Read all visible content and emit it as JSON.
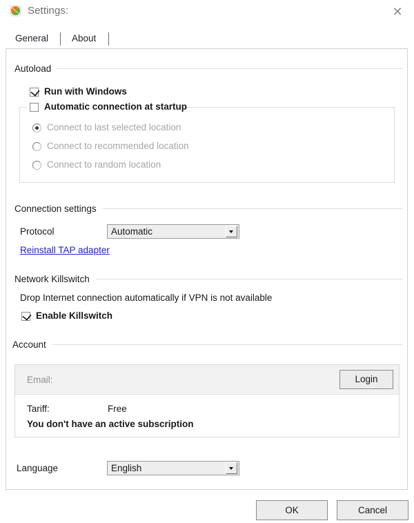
{
  "window": {
    "title": "Settings:",
    "app_icon": "vpn-swirl-icon",
    "close_icon": "close-icon"
  },
  "tabs": [
    {
      "label": "General",
      "active": true
    },
    {
      "label": "About",
      "active": false
    }
  ],
  "sections": {
    "autoload": {
      "header": "Autoload",
      "run_with_windows": {
        "label": "Run with Windows",
        "checked": true
      },
      "auto_connect": {
        "label": "Automatic connection at startup",
        "checked": false
      },
      "radios": [
        {
          "label": "Connect to last selected location",
          "selected": true,
          "disabled": true
        },
        {
          "label": "Connect to recommended location",
          "selected": false,
          "disabled": true
        },
        {
          "label": "Connect to random location",
          "selected": false,
          "disabled": true
        }
      ]
    },
    "connection": {
      "header": "Connection settings",
      "protocol_label": "Protocol",
      "protocol_value": "Automatic",
      "reinstall_link": "Reinstall TAP adapter"
    },
    "killswitch": {
      "header": "Network Killswitch",
      "description": "Drop Internet connection automatically if VPN is not available",
      "enable": {
        "label": "Enable Killswitch",
        "checked": true
      }
    },
    "account": {
      "header": "Account",
      "email_label": "Email:",
      "email_value": "",
      "login_button": "Login",
      "tariff_label": "Tariff:",
      "tariff_value": "Free",
      "subscription_status": "You don't have an active subscription"
    },
    "language": {
      "label": "Language",
      "value": "English"
    }
  },
  "footer": {
    "ok": "OK",
    "cancel": "Cancel"
  },
  "colors": {
    "link": "#2222cc",
    "title_text": "#6e6e6e",
    "disabled_text": "#a6a6a6",
    "panel_border": "#d2d2d2"
  }
}
